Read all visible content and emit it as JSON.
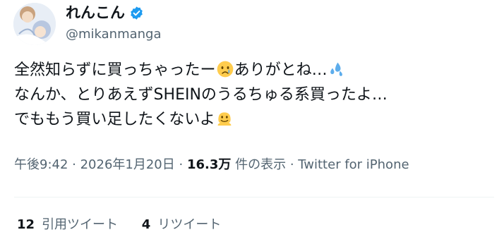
{
  "author": {
    "display_name": "れんこん",
    "handle": "@mikanmanga",
    "verified": true
  },
  "tweet": {
    "line1_before": "全然知らずに買っちゃったー",
    "line1_after": "ありがとね…",
    "line2": "なんか、とりあえずSHEINのうるちゅる系買ったよ…",
    "line3": "でももう買い足したくないよ",
    "emoji_icons": [
      "crying-face-icon",
      "sweat-droplets-icon",
      "melting-face-icon"
    ]
  },
  "meta": {
    "time": "午後9:42",
    "sep1": " · ",
    "date": "2026年1月20日",
    "sep2": " · ",
    "views_count": "16.3万",
    "views_label": " 件の表示",
    "sep3": " · ",
    "source": "Twitter for iPhone"
  },
  "stats": {
    "quote_count": "12",
    "quote_label": "引用ツイート",
    "retweet_count": "4",
    "retweet_label": "リツイート"
  },
  "colors": {
    "verified_blue": "#1d9bf0",
    "secondary_text": "#536471",
    "primary_text": "#0f1419"
  }
}
